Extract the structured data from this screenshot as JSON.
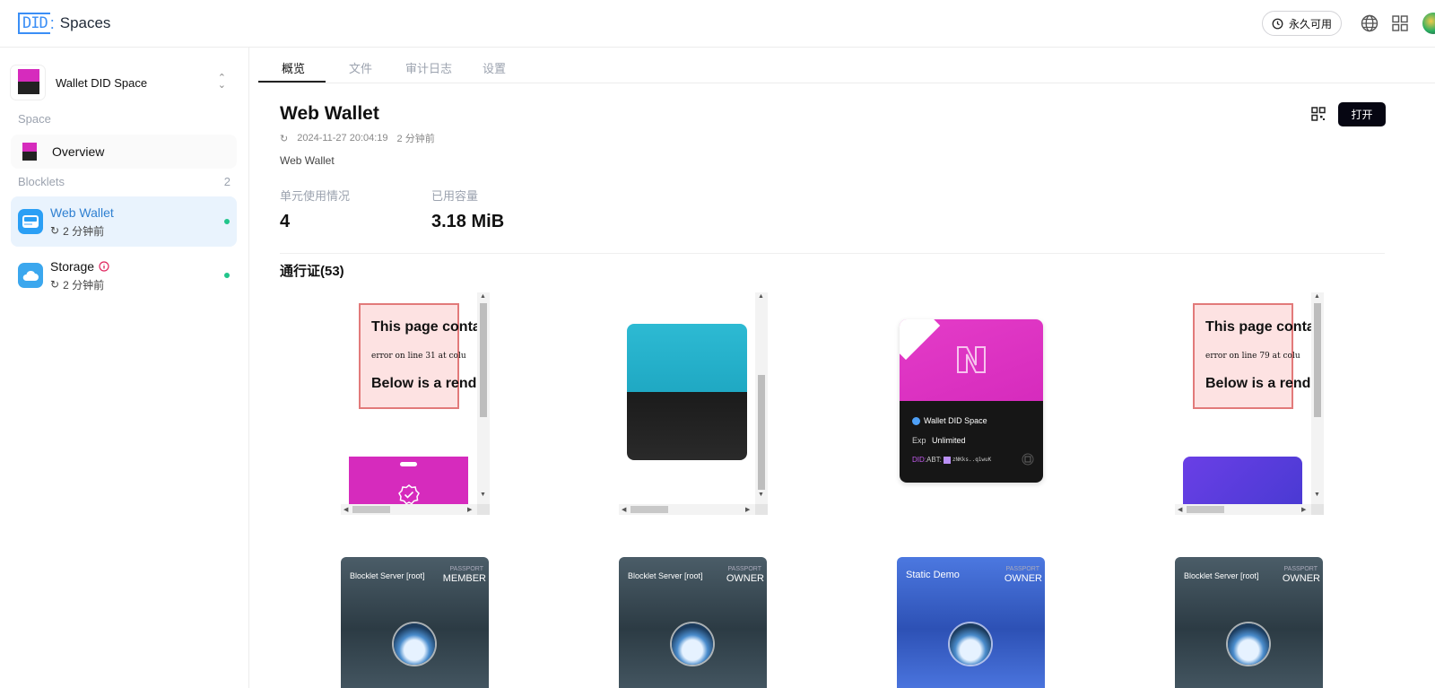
{
  "app": {
    "logo_prefix": "DID",
    "logo_name": "Spaces"
  },
  "topbar": {
    "availability_label": "永久可用"
  },
  "sidebar": {
    "space_name": "Wallet DID Space",
    "space_section_label": "Space",
    "overview_label": "Overview",
    "blocklets_label": "Blocklets",
    "blocklets_count": "2",
    "blocklets": [
      {
        "name": "Web Wallet",
        "time": "2 分钟前",
        "active": true
      },
      {
        "name": "Storage",
        "time": "2 分钟前",
        "active": false
      }
    ]
  },
  "tabs": [
    {
      "label": "概览",
      "active": true
    },
    {
      "label": "文件",
      "active": false
    },
    {
      "label": "审计日志",
      "active": false
    },
    {
      "label": "设置",
      "active": false
    }
  ],
  "detail": {
    "title": "Web Wallet",
    "timestamp": "2024-11-27 20:04:19",
    "relative_time": "2 分钟前",
    "description": "Web Wallet",
    "open_label": "打开",
    "stats": [
      {
        "label": "单元使用情况",
        "value": "4"
      },
      {
        "label": "已用容量",
        "value": "3.18 MiB"
      }
    ]
  },
  "passes": {
    "title": "通行证(53)",
    "error_frame": {
      "heading": "This page conta",
      "line_text_1": "error on line 31 at colu",
      "line_text_2": "error on line 79 at colu",
      "below_text": "Below is a rend"
    },
    "did_card": {
      "space_name": "Wallet DID Space",
      "exp_label": "Exp",
      "exp_value": "Unlimited",
      "did_prefix": "DID:",
      "did_value": "ABT:",
      "did_short": "zNKks..q1wuK"
    },
    "cards": [
      {
        "issuer": "Blocklet Server [root]",
        "passport_label": "PASSPORT",
        "role": "MEMBER",
        "color": "#334550"
      },
      {
        "issuer": "Blocklet Server [root]",
        "passport_label": "PASSPORT",
        "role": "OWNER",
        "color": "#334550"
      },
      {
        "issuer": "Static Demo",
        "passport_label": "PASSPORT",
        "role": "OWNER",
        "color": "#3d67d6"
      },
      {
        "issuer": "Blocklet Server [root]",
        "passport_label": "PASSPORT",
        "role": "OWNER",
        "color": "#334550"
      }
    ]
  },
  "colors": {
    "accent": "#2f80d1",
    "brand": "#3a8ef6",
    "success": "#22c58b",
    "primary_button": "#060612",
    "magenta": "#d62bbd"
  }
}
